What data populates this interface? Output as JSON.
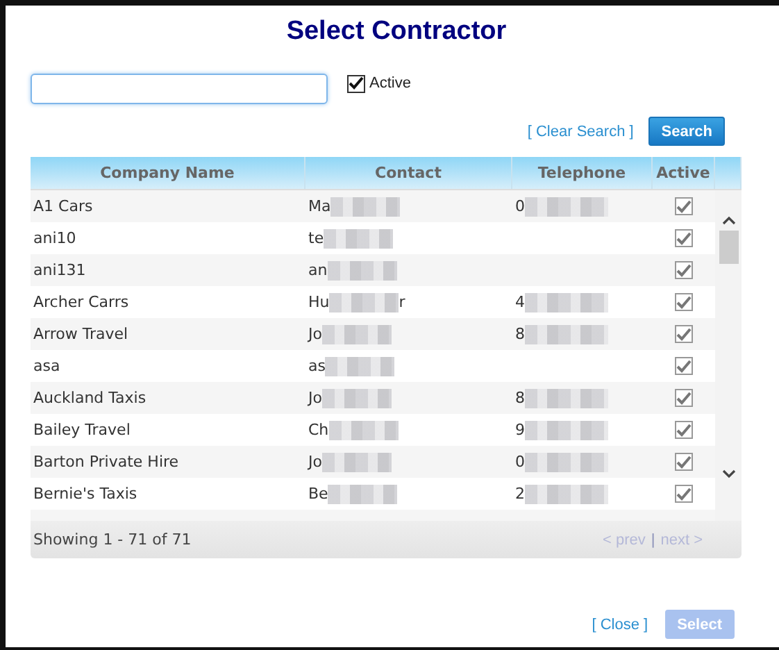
{
  "title": "Select Contractor",
  "search": {
    "active_filter": {
      "label": "Active",
      "checked": true
    },
    "clear_link": "[ Clear Search ]",
    "button": "Search"
  },
  "table": {
    "columns": [
      "Company Name",
      "Contact",
      "Telephone",
      "Active"
    ],
    "rows": [
      {
        "company": "A1 Cars",
        "contact": [
          {
            "kind": "text",
            "text": "Ma"
          },
          {
            "kind": "redacted"
          }
        ],
        "telephone": [
          {
            "kind": "text",
            "text": "0"
          },
          {
            "kind": "redacted"
          }
        ],
        "active": true
      },
      {
        "company": "ani10",
        "contact": [
          {
            "kind": "text",
            "text": "te"
          },
          {
            "kind": "redacted"
          }
        ],
        "telephone": [],
        "active": true
      },
      {
        "company": "ani131",
        "contact": [
          {
            "kind": "text",
            "text": "an"
          },
          {
            "kind": "redacted"
          }
        ],
        "telephone": [],
        "active": true
      },
      {
        "company": "Archer Carrs",
        "contact": [
          {
            "kind": "text",
            "text": "Hu"
          },
          {
            "kind": "redacted"
          },
          {
            "kind": "text",
            "text": "r"
          }
        ],
        "telephone": [
          {
            "kind": "text",
            "text": "4"
          },
          {
            "kind": "redacted"
          }
        ],
        "active": true
      },
      {
        "company": "Arrow Travel",
        "contact": [
          {
            "kind": "text",
            "text": "Jo"
          },
          {
            "kind": "redacted"
          }
        ],
        "telephone": [
          {
            "kind": "text",
            "text": "8"
          },
          {
            "kind": "redacted"
          }
        ],
        "active": true
      },
      {
        "company": "asa",
        "contact": [
          {
            "kind": "text",
            "text": "as"
          },
          {
            "kind": "redacted"
          }
        ],
        "telephone": [],
        "active": true
      },
      {
        "company": "Auckland Taxis",
        "contact": [
          {
            "kind": "text",
            "text": "Jo"
          },
          {
            "kind": "redacted"
          }
        ],
        "telephone": [
          {
            "kind": "text",
            "text": "8"
          },
          {
            "kind": "redacted"
          }
        ],
        "active": true
      },
      {
        "company": "Bailey Travel",
        "contact": [
          {
            "kind": "text",
            "text": "Ch"
          },
          {
            "kind": "redacted"
          }
        ],
        "telephone": [
          {
            "kind": "text",
            "text": "9"
          },
          {
            "kind": "redacted"
          }
        ],
        "active": true
      },
      {
        "company": "Barton Private Hire",
        "contact": [
          {
            "kind": "text",
            "text": "Jo"
          },
          {
            "kind": "redacted"
          }
        ],
        "telephone": [
          {
            "kind": "text",
            "text": "0"
          },
          {
            "kind": "redacted"
          }
        ],
        "active": true
      },
      {
        "company": "Bernie's Taxis",
        "contact": [
          {
            "kind": "text",
            "text": "Be"
          },
          {
            "kind": "redacted"
          }
        ],
        "telephone": [
          {
            "kind": "text",
            "text": "2"
          },
          {
            "kind": "redacted"
          }
        ],
        "active": true
      }
    ],
    "footer": {
      "summary": "Showing 1 - 71 of 71",
      "prev": "< prev",
      "separator": "|",
      "next": "next >"
    }
  },
  "actions": {
    "close_link": "[ Close ]",
    "select_button": {
      "label": "Select",
      "disabled": true
    }
  }
}
